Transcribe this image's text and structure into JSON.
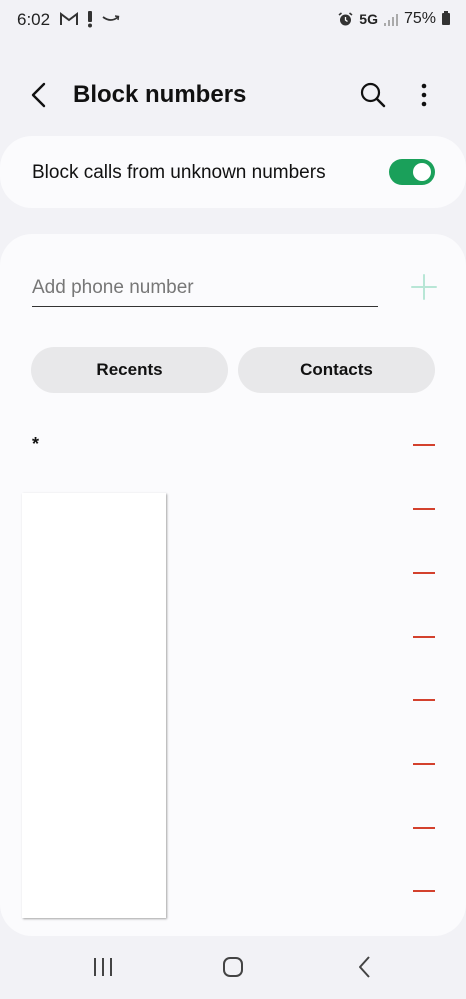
{
  "status_bar": {
    "time": "6:02",
    "network": "5G",
    "battery": "75%",
    "icons": [
      "gmail-icon",
      "alert-icon",
      "amazon-icon",
      "alarm-icon",
      "signal-icon",
      "battery-icon"
    ]
  },
  "header": {
    "title": "Block numbers",
    "back_icon": "chevron-left-icon",
    "search_icon": "search-icon",
    "more_icon": "more-vert-icon"
  },
  "block_unknown": {
    "label": "Block calls from unknown numbers",
    "enabled": true,
    "accent": "#1aa05a"
  },
  "add_number": {
    "placeholder": "Add phone number",
    "value": ""
  },
  "buttons": {
    "recents": "Recents",
    "contacts": "Contacts"
  },
  "blocked_list": {
    "first_entry": "*",
    "remove_color": "#d3412d"
  }
}
